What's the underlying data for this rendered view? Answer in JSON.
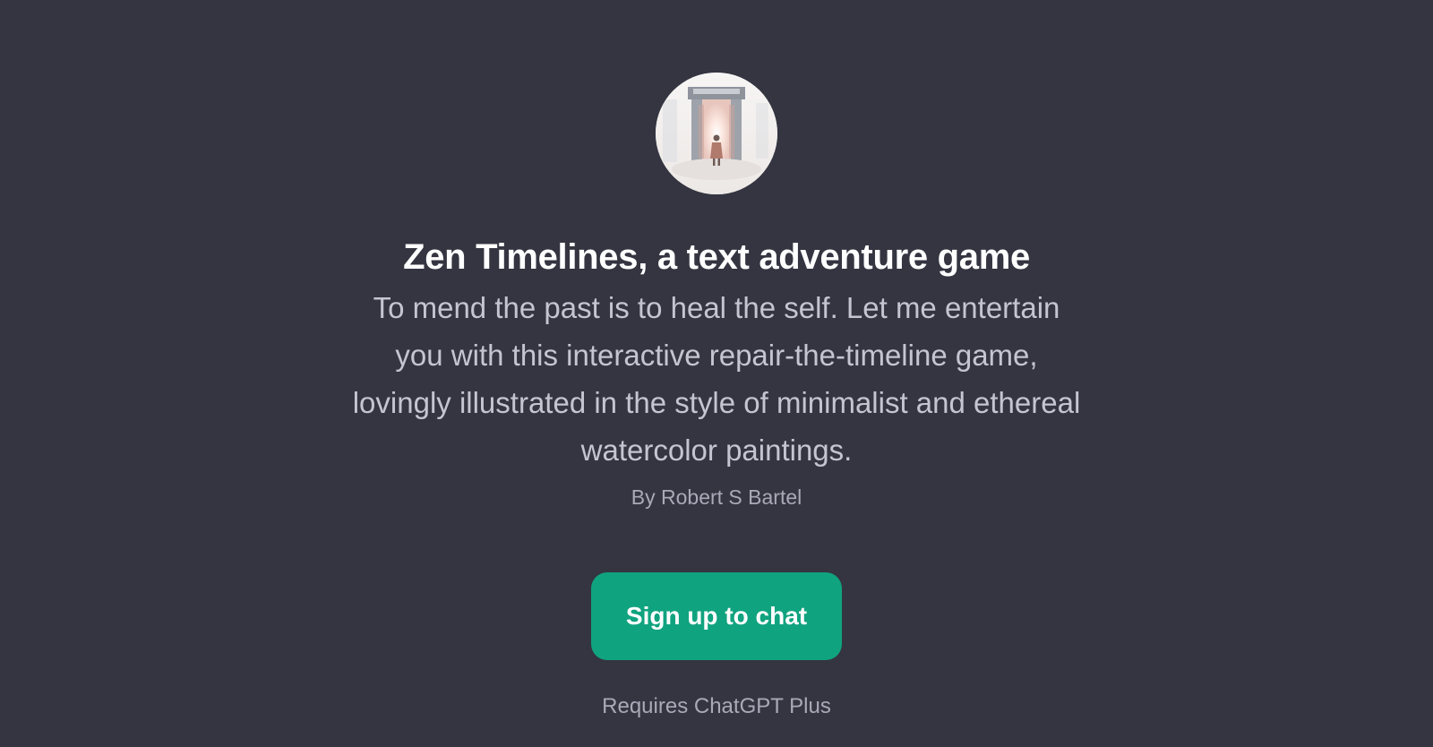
{
  "gpt": {
    "avatar_icon": "gateway-watercolor-avatar",
    "title": "Zen Timelines, a text adventure game",
    "description": "To mend the past is to heal the self. Let me entertain you with this interactive repair-the-timeline game, lovingly illustrated in the style of minimalist and ethereal watercolor paintings.",
    "author": "By Robert S Bartel"
  },
  "cta": {
    "signup_label": "Sign up to chat",
    "requirement": "Requires ChatGPT Plus"
  },
  "colors": {
    "background": "#343541",
    "accent": "#10a37f",
    "title": "#ffffff",
    "body_text": "#c5c5d2",
    "muted_text": "#a9a9b8"
  }
}
